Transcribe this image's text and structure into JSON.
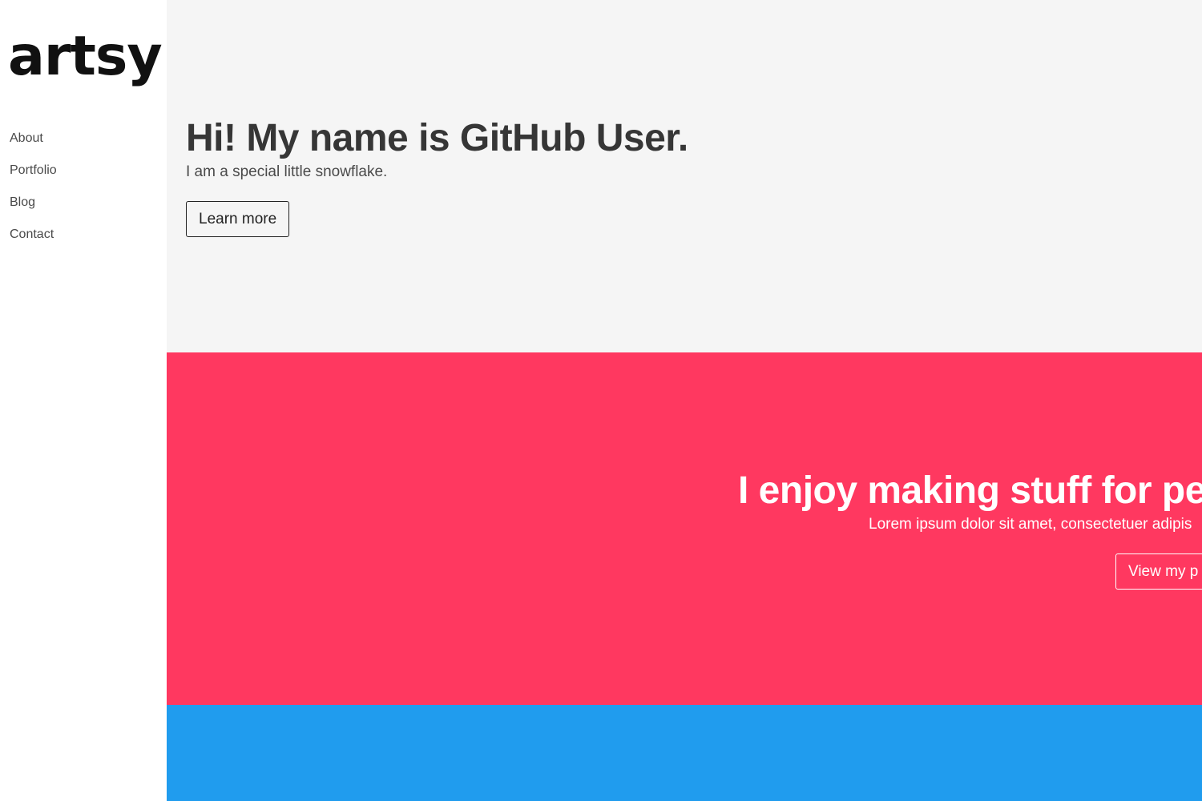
{
  "sidebar": {
    "logo": "artsy",
    "nav": [
      {
        "label": "About"
      },
      {
        "label": "Portfolio"
      },
      {
        "label": "Blog"
      },
      {
        "label": "Contact"
      }
    ]
  },
  "hero": {
    "title": "Hi! My name is GitHub User.",
    "subtitle": "I am a special little snowflake.",
    "button_label": "Learn more"
  },
  "feature": {
    "title": "I enjoy making stuff for peo",
    "subtitle": "Lorem ipsum dolor sit amet, consectetuer adipis",
    "button_label": "View my p"
  },
  "colors": {
    "hero_bg": "#f5f5f5",
    "feature_bg": "#ff3860",
    "bottom_bg": "#209cee"
  }
}
